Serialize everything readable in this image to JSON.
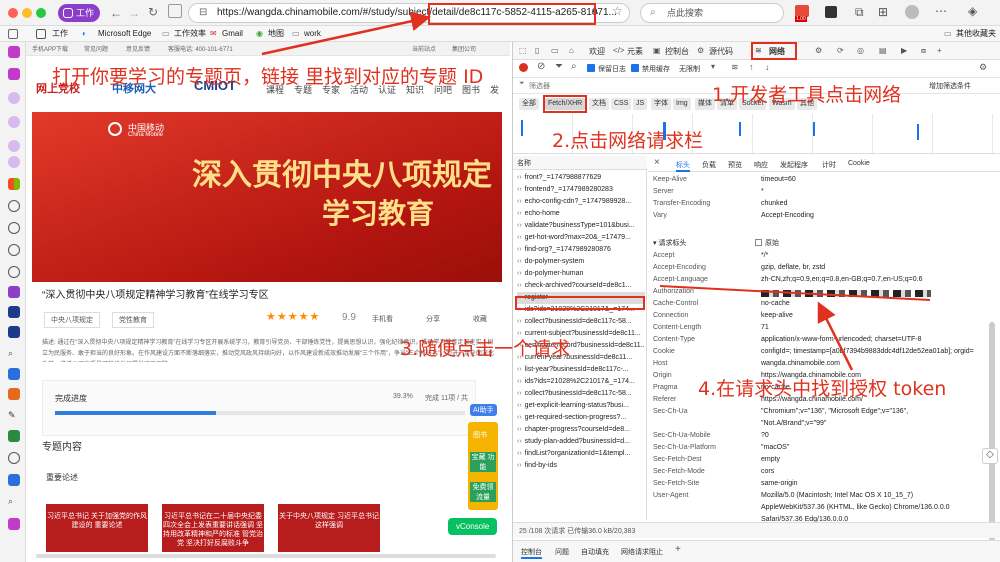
{
  "browser": {
    "workspace_label": "工作",
    "tab_label": "工作",
    "url": "https://wangda.chinamobile.com/#/study/subject/detail/de8c117c-5852-4115-a265-81071...",
    "url_suffix": "A",
    "search_placeholder": "点此搜索",
    "badge_count": "1.00",
    "bookmarks": [
      "Microsoft Edge",
      "工作效率",
      "Gmail",
      "地图",
      "work",
      "其他收藏夹"
    ]
  },
  "page": {
    "topstrip": [
      "手机APP下载",
      "常见问题",
      "意见反馈",
      "客服电话: 400-101-6771"
    ],
    "topstrip_right": [
      "当前站点",
      "集团公司"
    ],
    "logos": [
      "网上党校",
      "中移网大",
      "CMIOT"
    ],
    "nav": [
      "课程",
      "专题",
      "专家",
      "活动",
      "认证",
      "知识",
      "问吧",
      "图书",
      "发"
    ],
    "banner_brand_cn": "中国移动",
    "banner_brand_en": "China Mobile",
    "banner_line1": "深入贯彻中央八项规定",
    "banner_line2": "学习教育",
    "subject_title": "“深入贯彻中央八项规定精神学习教育”在线学习专区",
    "tags": [
      "中央八项规定",
      "党性教育"
    ],
    "rating": "9.9",
    "actions": [
      "手机看",
      "分享",
      "收藏"
    ],
    "description": "描述: 通过在“深入贯彻中央八项规定精神学习教育”在线学习专区开展系统学习，教育引导党员、干部锤炼党性，提高思想认识，强化纪律意识，推动学习教育走深走实，树立为民服务、敢于担当的良好形象。在作风建设方面不断落细落实，推动党风政风持续向好，以作风建设新成效推动发展“三个作用”，争当“三个排头兵”，为进一步全面深化改革、推进公司高质量可持续发展提供坚强保障。",
    "progress_label": "完成进度",
    "progress_percent": "39.3%",
    "progress_value": 0.393,
    "progress_count": "完成 11项 / 共",
    "content_heading": "专题内容",
    "section_heading": "重要论述",
    "side_buttons": [
      "图书",
      "宝藏 功能",
      "免费领 流量"
    ],
    "ai_label": "AI助手",
    "vconsole": "vConsole",
    "cards": [
      "习近平总书记 关于加强党的作风建设的 重要论述",
      "习近平总书记在二十届中央纪委 四次全会上发表重要讲话强调 坚持用改革精神和严的标准 管党治党 坚决打好反腐败斗争",
      "关于中央八项规定 习近平总书记这样强调"
    ]
  },
  "devtools": {
    "tabs": [
      "欢迎",
      "元素",
      "控制台",
      "源代码",
      "网络"
    ],
    "toolbar": [
      "保留日志",
      "禁用缓存",
      "无限制"
    ],
    "filter_placeholder": "筛选器",
    "more_filters": "增加筛选条件",
    "type_filters": [
      "全部",
      "Fetch/XHR",
      "文档",
      "CSS",
      "JS",
      "字体",
      "Img",
      "媒体",
      "清单",
      "Socket",
      "Wasm",
      "其他"
    ],
    "name_header": "名称",
    "detail_tabs": [
      "标头",
      "负载",
      "预览",
      "响应",
      "发起程序",
      "计时",
      "Cookie"
    ],
    "requests": [
      "front?_=1747988877629",
      "frontend?_=1747989280283",
      "echo-config-cdn?_=1747989928...",
      "echo-home",
      "validate?businessType=101&busi...",
      "get-hot-word?max=20&_=17479...",
      "find-org?_=1747989280876",
      "do-polymer-system",
      "do-polymer-human",
      "check-archived?courseId=de8c1...",
      "register",
      "ids?ids=21028%2C21017&_=174...",
      "collect?businessId=de8c117c-58...",
      "current-subject?businessId=de8c11...",
      "certificate-record?businessId=de8c11...",
      "current-year?businessId=de8c11...",
      "list-year?businessId=de8c117c-...",
      "ids?ids=21028%2C21017&_=174...",
      "collect?businessId=de8c117c-58...",
      "get-explicit-learning-status?busi...",
      "get-required-section-progress?...",
      "chapter-progress?courseId=de8...",
      "study-plan-added?businessId=d...",
      "findList?organizationId=1&templ...",
      "find-by-ids"
    ],
    "selected_request": "register",
    "response_headers": [
      [
        "Keep-Alive",
        "timeout=60"
      ],
      [
        "Server",
        "*"
      ],
      [
        "Transfer-Encoding",
        "chunked"
      ],
      [
        "Vary",
        "Accept-Encoding"
      ]
    ],
    "request_headers_title": "请求标头",
    "raw_label": "原始",
    "request_headers": [
      [
        "Accept",
        "*/*"
      ],
      [
        "Accept-Encoding",
        "gzip, deflate, br, zstd"
      ],
      [
        "Accept-Language",
        "zh-CN,zh;q=0.9,en;q=0.8,en-GB;q=0.7,en-US;q=0.6"
      ],
      [
        "Authorization",
        ""
      ],
      [
        "Cache-Control",
        "no-cache"
      ],
      [
        "Connection",
        "keep-alive"
      ],
      [
        "Content-Length",
        "71"
      ],
      [
        "Content-Type",
        "application/x-www-form-urlencoded; charset=UTF-8"
      ],
      [
        "Cookie",
        "configId=; timestamp=[a0bf7394b9883ddc4df12de52ea01ab]; orgid="
      ],
      [
        "Host",
        "wangda.chinamobile.com"
      ],
      [
        "Origin",
        "https://wangda.chinamobile.com"
      ],
      [
        "Pragma",
        "no-cache"
      ],
      [
        "Referer",
        "https://wangda.chinamobile.com/"
      ],
      [
        "Sec-Ch-Ua",
        "\"Chromium\";v=\"136\", \"Microsoft Edge\";v=\"136\","
      ],
      [
        "",
        "\"Not.A/Brand\";v=\"99\""
      ],
      [
        "Sec-Ch-Ua-Mobile",
        "?0"
      ],
      [
        "Sec-Ch-Ua-Platform",
        "\"macOS\""
      ],
      [
        "Sec-Fetch-Dest",
        "empty"
      ],
      [
        "Sec-Fetch-Mode",
        "cors"
      ],
      [
        "Sec-Fetch-Site",
        "same-origin"
      ],
      [
        "User-Agent",
        "Mozilla/5.0 (Macintosh; Intel Mac OS X 10_15_7)"
      ],
      [
        "",
        "AppleWebKit/537.36 (KHTML, like Gecko) Chrome/136.0.0.0"
      ],
      [
        "",
        "Safari/537.36 Edg/136.0.0.0"
      ],
      [
        "X-Requested-With",
        "XMLHttpRequest"
      ]
    ],
    "status": "25 /108 次请求  已传输36.0 kB/20,383",
    "drawer_tabs": [
      "控制台",
      "问题",
      "自动填充",
      "网络请求阻止"
    ]
  },
  "annotations": {
    "step0": "打开你要学习的专题页，链接 里找到对应的专题 ID",
    "step1": "1.开发者工具点击网络",
    "step2": "2.点击网络请求栏",
    "step3": "3.随便点击一个请求",
    "step4": "4.在请求头中找到授权 token"
  },
  "colors": {
    "annotation": "#e0301e",
    "banner": "#c8201f",
    "accent": "#1a73e8",
    "selected_row": "#dcdcdc"
  }
}
